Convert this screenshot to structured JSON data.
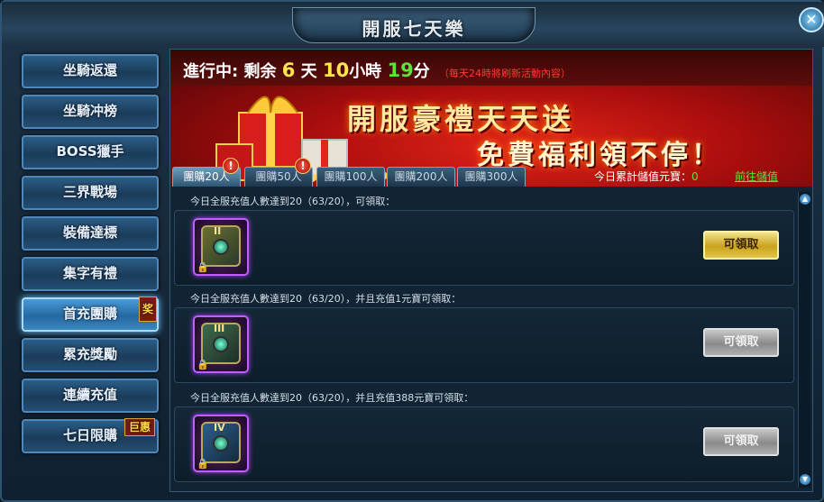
{
  "window": {
    "title": "開服七天樂",
    "close_label": "✕"
  },
  "sidebar": {
    "items": [
      {
        "label": "坐騎返還"
      },
      {
        "label": "坐騎冲榜"
      },
      {
        "label": "BOSS獵手"
      },
      {
        "label": "三界戰場"
      },
      {
        "label": "裝備達標"
      },
      {
        "label": "集字有禮"
      },
      {
        "label": "首充團購",
        "badge": "奖"
      },
      {
        "label": "累充獎勵"
      },
      {
        "label": "連續充值"
      },
      {
        "label": "七日限購",
        "badge": "巨惠"
      }
    ],
    "active_index": 6
  },
  "banner": {
    "status_label": "進行中:",
    "remaining_label": "剩余",
    "days": "6",
    "days_unit": "天",
    "hours": "10",
    "hours_unit": "小時",
    "minutes": "19",
    "minutes_unit": "分",
    "refresh_note": "（每天24時將刷新活動內容）",
    "slogan_line1": "開服豪禮天天送",
    "slogan_line2": "免費福利領不停！"
  },
  "tabs": [
    {
      "label": "團購20人",
      "alert": true
    },
    {
      "label": "團購50人",
      "alert": true
    },
    {
      "label": "團購100人",
      "alert": false
    },
    {
      "label": "團購200人",
      "alert": false
    },
    {
      "label": "團購300人",
      "alert": false
    }
  ],
  "active_tab": 0,
  "alert_symbol": "!",
  "total": {
    "label": "今日累計儲值元寶：",
    "value": "0",
    "link": "前往儲值"
  },
  "rewards": [
    {
      "condition": "今日全服充值人數達到20（63/20），可領取：",
      "cube_num": "II",
      "button": "可領取",
      "enabled": true
    },
    {
      "condition": "今日全服充值人數達到20（63/20），并且充值1元寶可領取：",
      "cube_num": "III",
      "button": "可領取",
      "enabled": false
    },
    {
      "condition": "今日全服充值人數達到20（63/20），并且充值388元寶可領取：",
      "cube_num": "IV",
      "button": "可領取",
      "enabled": false
    }
  ],
  "lock_symbol": "🔒",
  "scroll": {
    "up": "▲",
    "down": "▼"
  }
}
